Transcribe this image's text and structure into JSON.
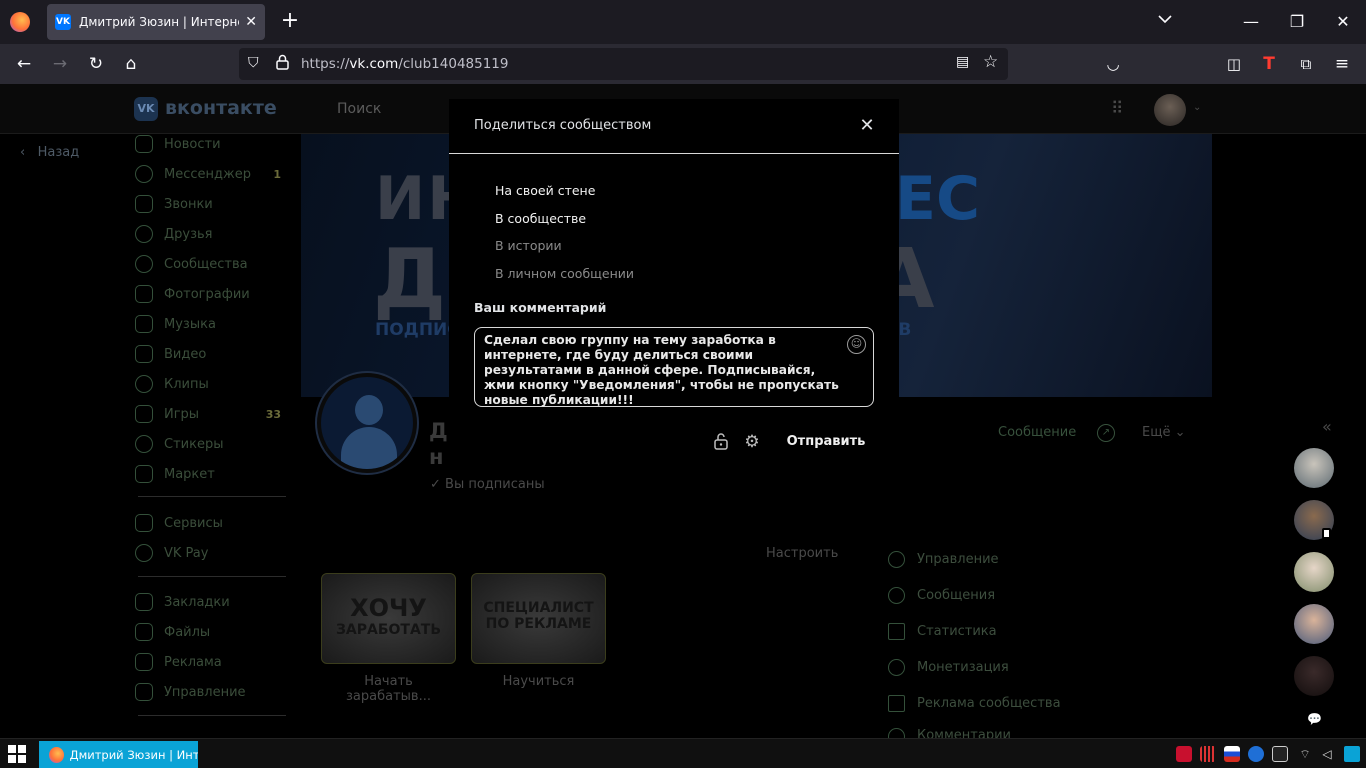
{
  "browser": {
    "tab_title": "Дмитрий Зюзин | Интернет - с",
    "url_prefix": "https://",
    "url_host": "vk.com",
    "url_path": "/club140485119"
  },
  "vk_header": {
    "logo_text": "вконтакте",
    "search_label": "Поиск"
  },
  "back_label": "Назад",
  "left_nav": {
    "items": [
      {
        "label": "Новости",
        "count": ""
      },
      {
        "label": "Мессенджер",
        "count": "1"
      },
      {
        "label": "Звонки",
        "count": ""
      },
      {
        "label": "Друзья",
        "count": ""
      },
      {
        "label": "Сообщества",
        "count": ""
      },
      {
        "label": "Фотографии",
        "count": ""
      },
      {
        "label": "Музыка",
        "count": ""
      },
      {
        "label": "Видео",
        "count": ""
      },
      {
        "label": "Клипы",
        "count": ""
      },
      {
        "label": "Игры",
        "count": "33"
      },
      {
        "label": "Стикеры",
        "count": ""
      },
      {
        "label": "Маркет",
        "count": ""
      },
      {
        "label": "Сервисы",
        "count": ""
      },
      {
        "label": "VK Pay",
        "count": ""
      },
      {
        "label": "Закладки",
        "count": ""
      },
      {
        "label": "Файлы",
        "count": ""
      },
      {
        "label": "Реклама",
        "count": ""
      },
      {
        "label": "Управление",
        "count": ""
      }
    ]
  },
  "cover": {
    "line1_left": "ИН",
    "line1_right": "ЕС",
    "line2_left": "ДЛ",
    "line2_right": "А",
    "line3_left": "ПОДПИСЫ",
    "line3_right": "ССОВ"
  },
  "group": {
    "name_line1": "Д",
    "name_line2": "н",
    "subscribed": "Вы подписаны",
    "message_button": "Сообщение",
    "more_button": "Ещё",
    "configure": "Настроить"
  },
  "tiles": [
    {
      "line1": "ХОЧУ",
      "line2": "ЗАРАБОТАТЬ",
      "caption": "Начать зарабатыв..."
    },
    {
      "line1": "СПЕЦИАЛИСТ",
      "line2": "ПО РЕКЛАМЕ",
      "caption": "Научиться"
    }
  ],
  "right_nav": {
    "items": [
      "Управление",
      "Сообщения",
      "Статистика",
      "Монетизация",
      "Реклама сообщества",
      "Комментарии"
    ]
  },
  "modal": {
    "title": "Поделиться сообществом",
    "options": [
      "На своей стене",
      "В сообществе",
      "В истории",
      "В личном сообщении"
    ],
    "comment_label": "Ваш комментарий",
    "comment_text": "Сделал свою группу на тему заработка в интернете, где буду делиться своими результатами в данной сфере. Подписывайся, жми кнопку \"Уведомления\", чтобы не пропускать новые публикации!!!",
    "send_button": "Отправить"
  },
  "taskbar": {
    "task_label": "Дмитрий Зюзин | Инт..."
  },
  "colors": {
    "modal_bg": "#000000",
    "vk_blue": "#0077ff",
    "taskbar_active": "#0aa3d6"
  },
  "icons": [
    "firefox-icon",
    "vk-favicon",
    "close-icon",
    "plus-icon",
    "chevron-down-icon",
    "minimize-icon",
    "restore-icon",
    "back-arrow-icon",
    "forward-arrow-icon",
    "reload-icon",
    "home-icon",
    "shield-icon",
    "lock-icon",
    "reader-icon",
    "star-icon",
    "pocket-icon",
    "sidebar-icon",
    "extensions-icon",
    "menu-icon",
    "apps-grid-icon",
    "emoji-icon",
    "gear-icon",
    "windows-start-icon"
  ]
}
